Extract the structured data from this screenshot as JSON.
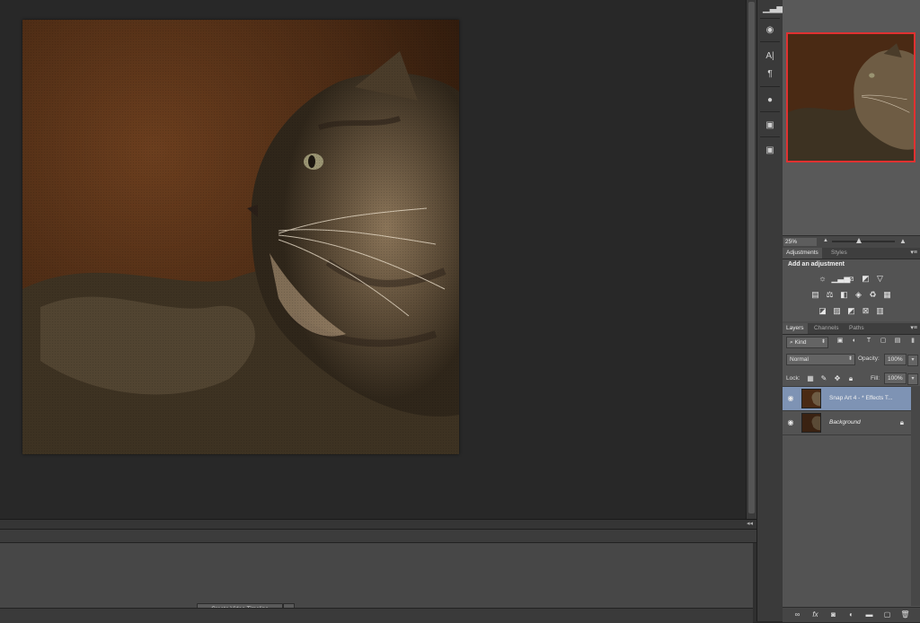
{
  "timeline": {
    "create_button_label": "Create Video Timeline"
  },
  "tool_strip": {
    "icons": [
      "histogram-icon",
      "info-icon",
      "character-icon",
      "paragraph-icon",
      "behance-icon",
      "layer-comps-icon",
      "clone-source-icon"
    ]
  },
  "navigator": {
    "zoom_value": "25%",
    "highlight_color": "#e03131"
  },
  "adjustments": {
    "tabs": [
      "Adjustments",
      "Styles"
    ],
    "title": "Add an adjustment"
  },
  "layers": {
    "tabs": [
      "Layers",
      "Channels",
      "Paths"
    ],
    "filter_kind": "Kind",
    "blend_mode": "Normal",
    "opacity_label": "Opacity:",
    "opacity_value": "100%",
    "lock_label": "Lock:",
    "fill_label": "Fill:",
    "fill_value": "100%",
    "items": [
      {
        "name": "Snap Art 4 - * Effects T...",
        "selected": true
      },
      {
        "name": "Background",
        "selected": false
      }
    ],
    "selected_color": "#7e93b4"
  }
}
